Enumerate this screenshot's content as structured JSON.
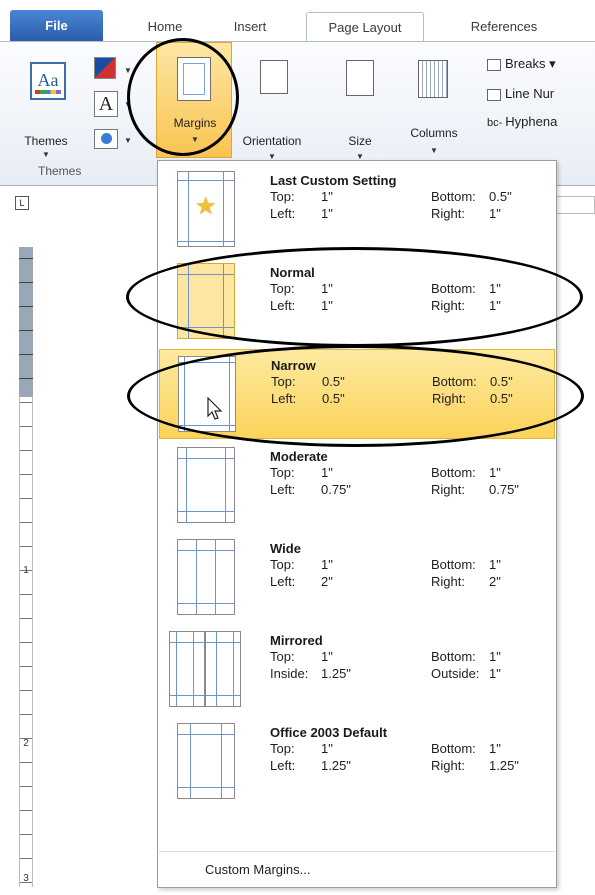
{
  "tabs": {
    "file": "File",
    "home": "Home",
    "insert": "Insert",
    "page_layout": "Page Layout",
    "references": "References"
  },
  "ribbon": {
    "themes": "Themes",
    "themes_group": "Themes",
    "fonts_glyph": "A",
    "margins": "Margins",
    "orientation": "Orientation",
    "size": "Size",
    "columns": "Columns",
    "breaks": "Breaks",
    "line_numbers": "Line Nur",
    "hyphenation": "Hyphena",
    "hyphen_prefix": "bc-"
  },
  "ruler": {
    "corner": "L",
    "num2": "2",
    "num3": "3",
    "num1": "1"
  },
  "dropdown": {
    "options": [
      {
        "name": "Last Custom Setting",
        "k1": "Top:",
        "v1": "1\"",
        "k2": "Bottom:",
        "v2": "0.5\"",
        "k3": "Left:",
        "v3": "1\"",
        "k4": "Right:",
        "v4": "1\""
      },
      {
        "name": "Normal",
        "k1": "Top:",
        "v1": "1\"",
        "k2": "Bottom:",
        "v2": "1\"",
        "k3": "Left:",
        "v3": "1\"",
        "k4": "Right:",
        "v4": "1\""
      },
      {
        "name": "Narrow",
        "k1": "Top:",
        "v1": "0.5\"",
        "k2": "Bottom:",
        "v2": "0.5\"",
        "k3": "Left:",
        "v3": "0.5\"",
        "k4": "Right:",
        "v4": "0.5\""
      },
      {
        "name": "Moderate",
        "k1": "Top:",
        "v1": "1\"",
        "k2": "Bottom:",
        "v2": "1\"",
        "k3": "Left:",
        "v3": "0.75\"",
        "k4": "Right:",
        "v4": "0.75\""
      },
      {
        "name": "Wide",
        "k1": "Top:",
        "v1": "1\"",
        "k2": "Bottom:",
        "v2": "1\"",
        "k3": "Left:",
        "v3": "2\"",
        "k4": "Right:",
        "v4": "2\""
      },
      {
        "name": "Mirrored",
        "k1": "Top:",
        "v1": "1\"",
        "k2": "Bottom:",
        "v2": "1\"",
        "k3": "Inside:",
        "v3": "1.25\"",
        "k4": "Outside:",
        "v4": "1\""
      },
      {
        "name": "Office 2003 Default",
        "k1": "Top:",
        "v1": "1\"",
        "k2": "Bottom:",
        "v2": "1\"",
        "k3": "Left:",
        "v3": "1.25\"",
        "k4": "Right:",
        "v4": "1.25\""
      }
    ],
    "custom_margins": "Custom Margins..."
  },
  "icons": [
    "themes-icon",
    "theme-colors-icon",
    "theme-fonts-icon",
    "theme-effects-icon",
    "margins-icon",
    "orientation-icon",
    "size-icon",
    "columns-icon",
    "breaks-icon",
    "line-numbers-icon",
    "hyphenation-icon",
    "star-icon",
    "cursor-icon"
  ],
  "colors": {
    "accent_tab": "#2a5caa",
    "highlight": "#fbd35b",
    "highlight_border": "#e3b535"
  }
}
